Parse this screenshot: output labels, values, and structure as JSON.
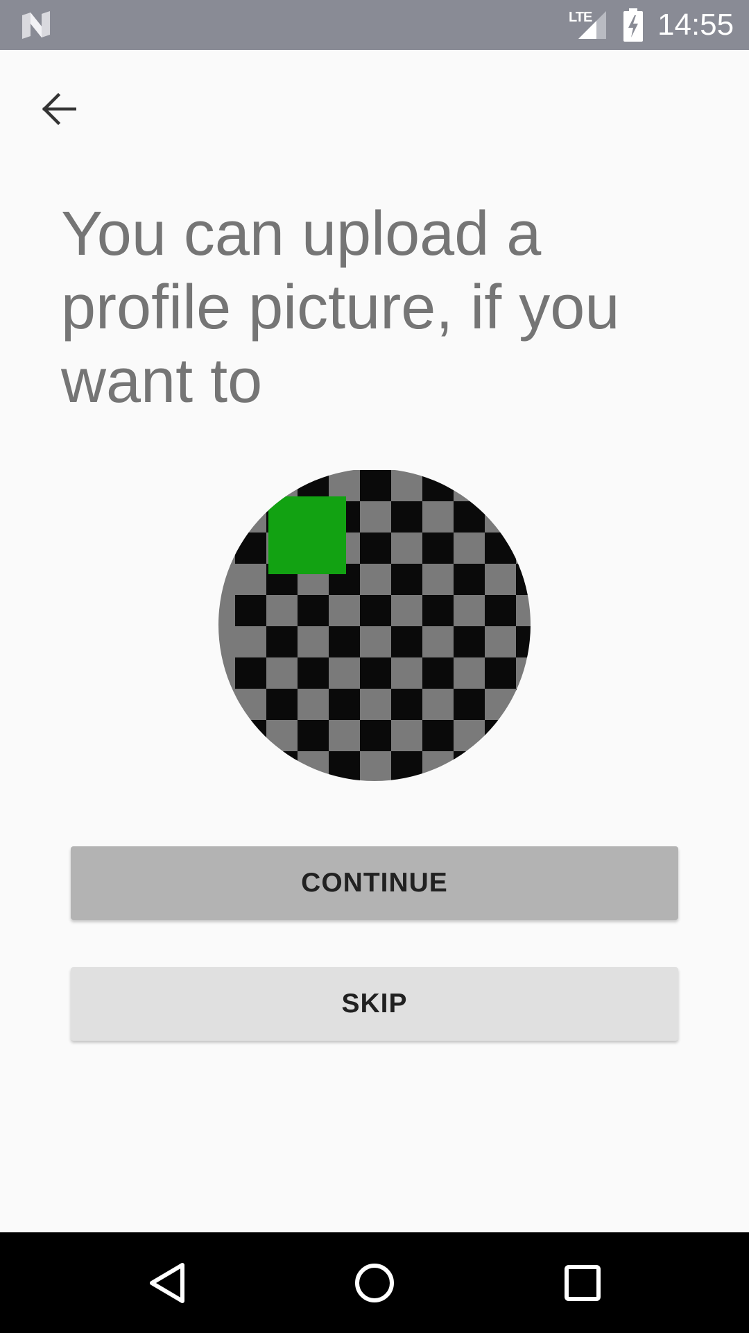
{
  "status_bar": {
    "network_label": "LTE",
    "time": "14:55",
    "icons": {
      "logo": "android-n-logo-icon",
      "signal": "signal-lte-icon",
      "battery": "battery-charging-icon"
    },
    "background_color": "#898b95"
  },
  "toolbar": {
    "back_icon": "arrow-back-icon"
  },
  "main": {
    "title": "You can upload a profile picture, if you want to",
    "avatar": {
      "icon": "profile-picture-placeholder",
      "pattern_colors": [
        "#0a0a0a",
        "#7a7a7a"
      ],
      "accent_color": "#12a212"
    },
    "buttons": {
      "continue_label": "CONTINUE",
      "skip_label": "SKIP"
    }
  },
  "nav_bar": {
    "back_icon": "nav-back-triangle-icon",
    "home_icon": "nav-home-circle-icon",
    "recents_icon": "nav-recents-square-icon"
  }
}
